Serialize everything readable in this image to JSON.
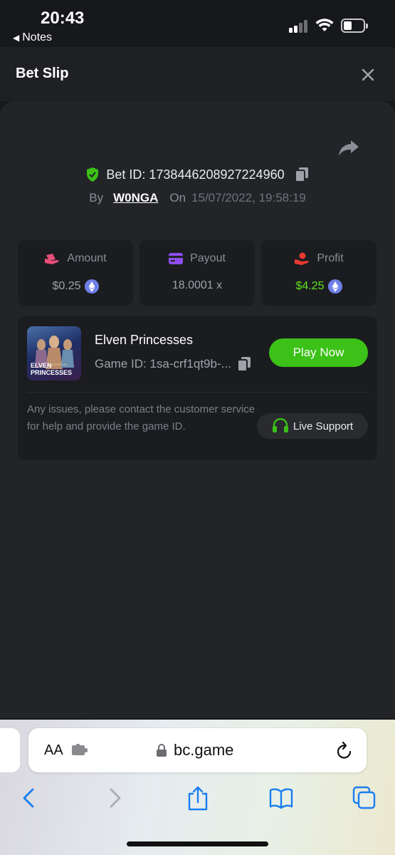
{
  "status_bar": {
    "time": "20:43",
    "back_app": "Notes"
  },
  "header": {
    "title": "Bet Slip"
  },
  "bet": {
    "bet_id_text": "Bet ID: 1738446208927224960",
    "by_label": "By",
    "user": "W0NGA",
    "on_label": "On",
    "datetime": "15/07/2022, 19:58:19"
  },
  "stats": {
    "amount": {
      "label": "Amount",
      "value": "$0.25"
    },
    "payout": {
      "label": "Payout",
      "value": "18.0001 x"
    },
    "profit": {
      "label": "Profit",
      "value": "$4.25"
    }
  },
  "game": {
    "thumb_text_line1": "ELVEN",
    "thumb_text_small": "of EVOPLAY",
    "thumb_text_line2": "PRINCESSES",
    "name": "Elven Princesses",
    "game_id": "Game ID: 1sa-crf1qt9b-...",
    "play_label": "Play Now",
    "issue_text": "Any issues, please contact the customer service for help and provide the game ID.",
    "support_label": "Live Support"
  },
  "safari": {
    "text_size": "AA",
    "url": "bc.game"
  },
  "colors": {
    "accent_green": "#3bc117",
    "profit_green": "#5fe31e",
    "background": "#17181b",
    "card": "#232428",
    "eth_blue": "#6f7fe8"
  },
  "icons": [
    "shield-check-icon",
    "copy-icon",
    "share-icon",
    "close-icon",
    "amount-icon",
    "payout-card-icon",
    "profit-icon",
    "eth-icon",
    "headset-icon",
    "lock-icon",
    "reload-icon",
    "back-icon",
    "forward-icon",
    "share-safari-icon",
    "bookmarks-icon",
    "tabs-icon"
  ]
}
